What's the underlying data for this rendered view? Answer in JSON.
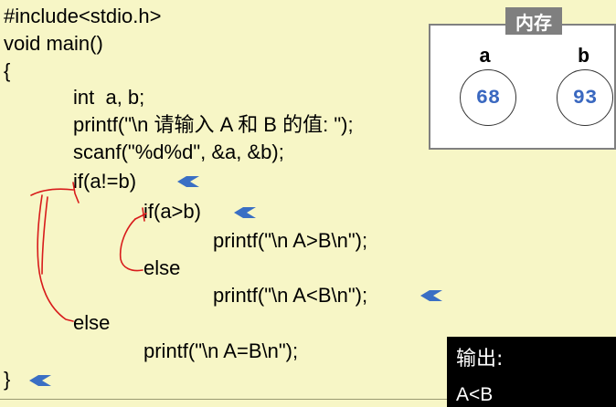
{
  "code": {
    "lines": [
      "#include<stdio.h>",
      "void main()",
      "{",
      "int  a, b;",
      "printf(\"\\n 请输入 A 和 B 的值: \");",
      "scanf(\"%d%d\", &a, &b);",
      "if(a!=b)",
      "if(a>b)",
      "printf(\"\\n A>B\\n\");",
      "else",
      "printf(\"\\n A<B\\n\");",
      "else",
      "printf(\"\\n A=B\\n\");",
      "}"
    ]
  },
  "memory": {
    "title": "内存",
    "variables": [
      {
        "name": "a",
        "value": "68"
      },
      {
        "name": "b",
        "value": "93"
      }
    ]
  },
  "output": {
    "title": "输出:",
    "text": "A<B"
  },
  "colors": {
    "background": "#f7f6c6",
    "arrow": "#3a6fc4",
    "annotation": "#d81b1b",
    "value": "#3a68c0"
  },
  "icons": [
    "step-arrow-icon"
  ]
}
